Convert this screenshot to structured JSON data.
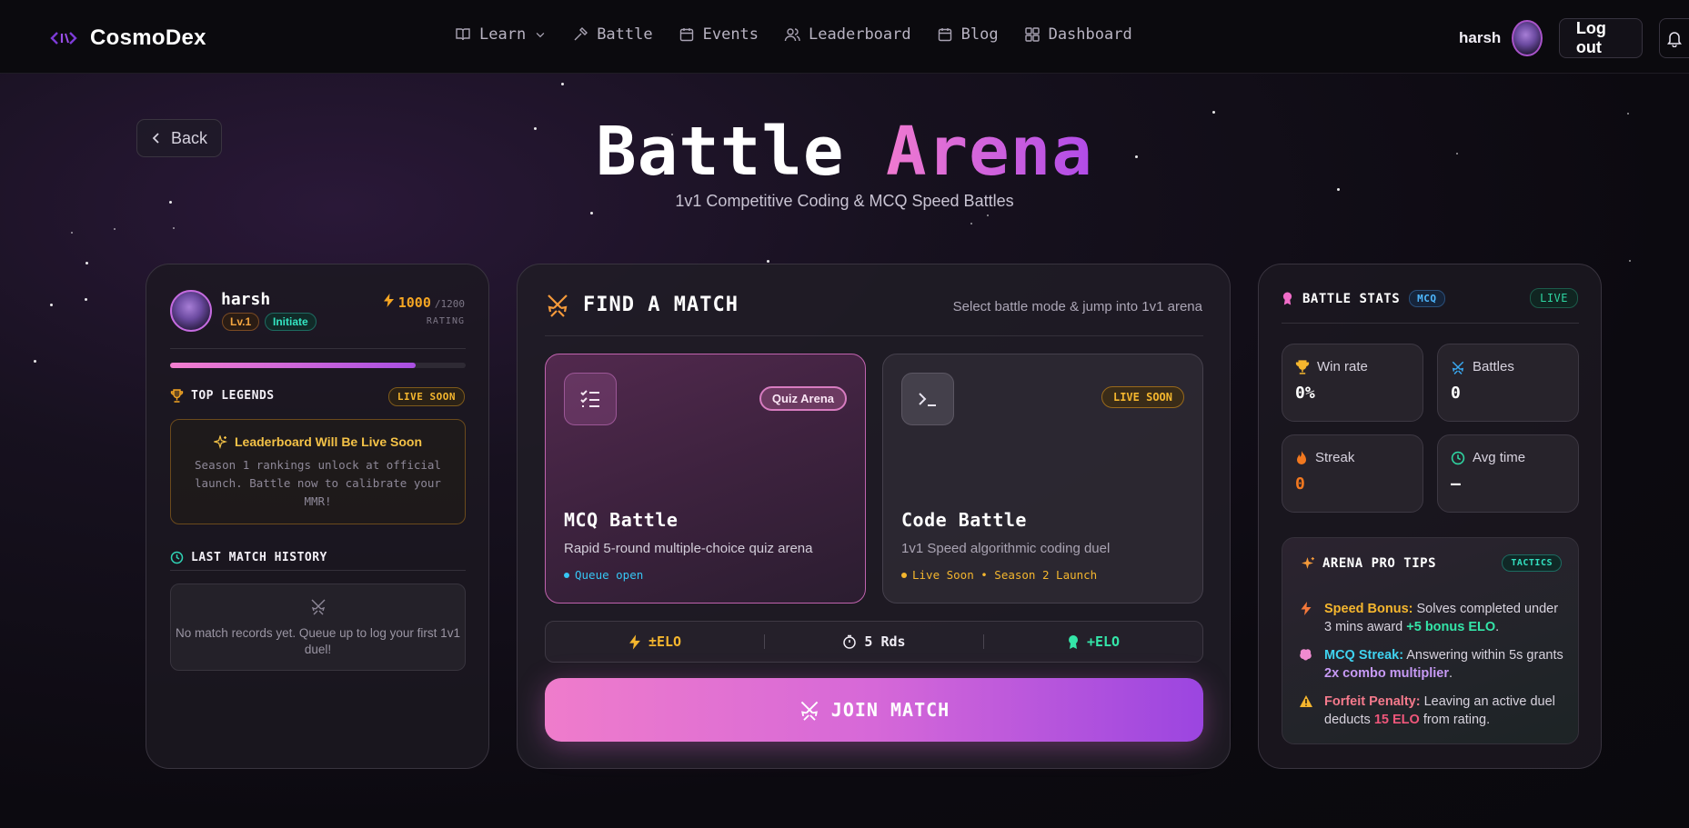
{
  "nav": {
    "brand": "CosmoDex",
    "items": [
      {
        "label": "Learn",
        "icon": "book-icon"
      },
      {
        "label": "Battle",
        "icon": "hammer-icon"
      },
      {
        "label": "Events",
        "icon": "calendar-icon"
      },
      {
        "label": "Leaderboard",
        "icon": "users-icon"
      },
      {
        "label": "Blog",
        "icon": "calendar-icon"
      },
      {
        "label": "Dashboard",
        "icon": "grid-icon"
      }
    ],
    "username": "harsh",
    "logout": "Log out"
  },
  "back": "Back",
  "header": {
    "title_a": "Battle",
    "title_b": "Arena",
    "subtitle": "1v1 Competitive Coding & MCQ Speed Battles"
  },
  "profile": {
    "name": "harsh",
    "level": "Lv.1",
    "rank": "Initiate",
    "rating": "1000",
    "rating_max": "/1200",
    "rating_label": "RATING",
    "xp_fraction": 0.83
  },
  "legends": {
    "title": "TOP LEGENDS",
    "badge": "LIVE SOON",
    "box_title": "Leaderboard Will Be Live Soon",
    "box_desc": "Season 1 rankings unlock at official launch. Battle now to calibrate your MMR!"
  },
  "history": {
    "title": "LAST MATCH HISTORY",
    "empty": "No match records yet. Queue up to log your first 1v1 duel!"
  },
  "find_match": {
    "title": "FIND A MATCH",
    "subtitle": "Select battle mode & jump into 1v1 arena",
    "mcq": {
      "tag": "Quiz Arena",
      "title": "MCQ Battle",
      "desc": "Rapid 5-round multiple-choice quiz arena",
      "status": "Queue open"
    },
    "code": {
      "tag": "LIVE SOON",
      "title": "Code Battle",
      "desc": "1v1 Speed algorithmic coding duel",
      "status": "Live Soon • Season 2 Launch"
    },
    "strip": [
      "±ELO",
      "5 Rds",
      "+ELO"
    ],
    "join": "JOIN MATCH"
  },
  "stats": {
    "title": "BATTLE STATS",
    "mode": "MCQ",
    "live": "LIVE",
    "cards": [
      {
        "label": "Win rate",
        "value": "0%"
      },
      {
        "label": "Battles",
        "value": "0"
      },
      {
        "label": "Streak",
        "value": "0"
      },
      {
        "label": "Avg time",
        "value": "—"
      }
    ]
  },
  "tips": {
    "title": "ARENA PRO TIPS",
    "badge": "TACTICS",
    "items": [
      {
        "head": "Speed Bonus:",
        "text": " Solves completed under 3 mins award ",
        "hl": "+5 bonus ELO",
        "end": "."
      },
      {
        "head": "MCQ Streak:",
        "text": " Answering within 5s grants ",
        "hl": "2x combo multiplier",
        "end": "."
      },
      {
        "head": "Forfeit Penalty:",
        "text": " Leaving an active duel deducts ",
        "hl": "15 ELO",
        "end": " from rating."
      }
    ]
  },
  "colors": {
    "accent_pink": "#ef7ccb",
    "accent_purple": "#9b45e0",
    "gold": "#f5a623",
    "teal": "#34e5c2"
  }
}
